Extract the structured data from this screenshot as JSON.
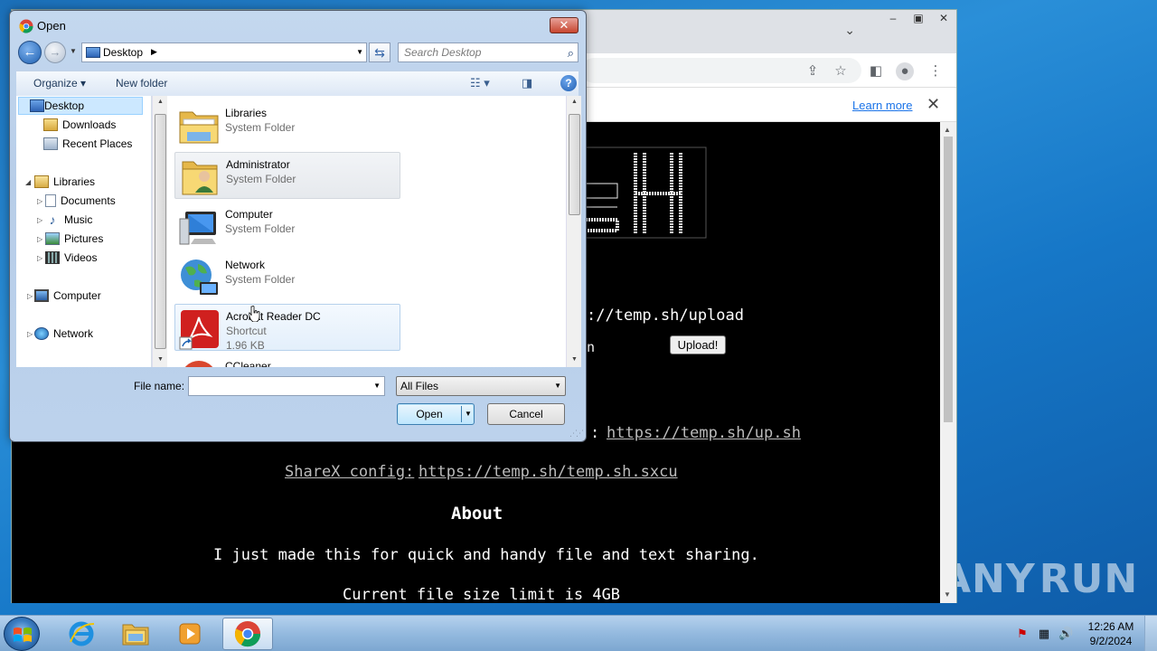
{
  "watermark": {
    "left": "ANY",
    "right": "RUN"
  },
  "browser": {
    "infobar": {
      "learn_more": "Learn more"
    },
    "page": {
      "upload_url": "://temp.sh/upload",
      "upload_button": "Upload!",
      "upsh_prefix": ":",
      "upsh_link": "https://temp.sh/up.sh",
      "sharex_label": "ShareX config:",
      "sharex_link": "https://temp.sh/temp.sh.sxcu",
      "about_heading": "About",
      "about_text": "I just made this for quick and handy file and text sharing.",
      "limit_text": "Current file size limit is 4GB",
      "partial_left_text": "n"
    }
  },
  "dialog": {
    "title": "Open",
    "close_label": "✕",
    "address": {
      "location": "Desktop"
    },
    "search": {
      "placeholder": "Search Desktop"
    },
    "toolbar": {
      "organize": "Organize",
      "new_folder": "New folder"
    },
    "nav": {
      "favorites": [
        {
          "label": "Desktop",
          "selected": true
        },
        {
          "label": "Downloads"
        },
        {
          "label": "Recent Places"
        }
      ],
      "libraries": {
        "label": "Libraries",
        "items": [
          "Documents",
          "Music",
          "Pictures",
          "Videos"
        ]
      },
      "computer": "Computer",
      "network": "Network"
    },
    "files": [
      {
        "name": "Libraries",
        "type": "System Folder",
        "icon": "libraries-folder-icon"
      },
      {
        "name": "Administrator",
        "type": "System Folder",
        "icon": "user-folder-icon",
        "state": "hover"
      },
      {
        "name": "Computer",
        "type": "System Folder",
        "icon": "computer-icon"
      },
      {
        "name": "Network",
        "type": "System Folder",
        "icon": "network-globe-icon"
      },
      {
        "name": "Acrobat Reader DC",
        "type": "Shortcut",
        "size": "1.96 KB",
        "icon": "acrobat-reader-icon",
        "state": "selected"
      },
      {
        "name": "CCleaner",
        "type": "",
        "icon": "ccleaner-icon"
      }
    ],
    "filename": {
      "label": "File name:",
      "value": ""
    },
    "filter": {
      "selected": "All Files"
    },
    "buttons": {
      "open": "Open",
      "cancel": "Cancel"
    }
  },
  "taskbar": {
    "apps": [
      "internet-explorer-icon",
      "file-explorer-icon",
      "media-player-icon",
      "chrome-icon"
    ],
    "clock": {
      "time": "12:26 AM",
      "date": "9/2/2024"
    }
  },
  "colors": {
    "link": "#1a73e8",
    "page_bg": "#000000",
    "dialog_frame": "#c4d8ef",
    "selection": "#cce8ff"
  }
}
